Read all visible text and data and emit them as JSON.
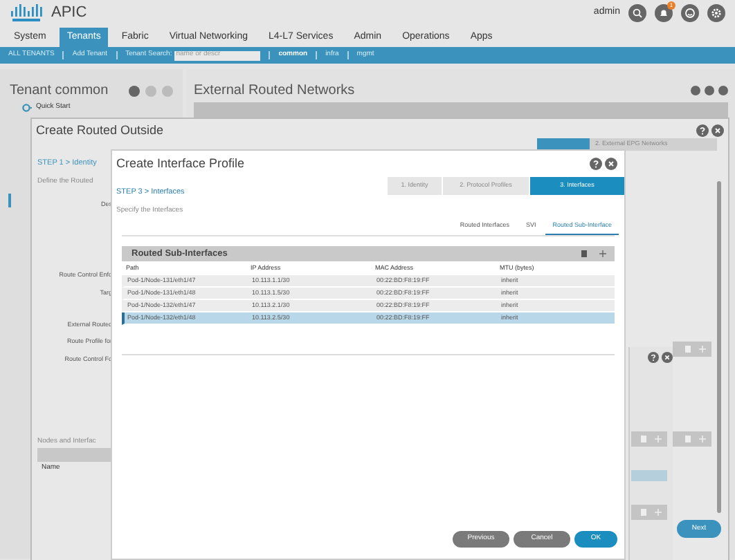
{
  "header": {
    "app_title": "APIC",
    "user": "admin",
    "notifications": "1"
  },
  "tabs": [
    {
      "label": "System",
      "selected": false
    },
    {
      "label": "Tenants",
      "selected": true
    },
    {
      "label": "Fabric",
      "selected": false
    },
    {
      "label": "Virtual Networking",
      "selected": false
    },
    {
      "label": "L4-L7 Services",
      "selected": false
    },
    {
      "label": "Admin",
      "selected": false
    },
    {
      "label": "Operations",
      "selected": false
    },
    {
      "label": "Apps",
      "selected": false
    }
  ],
  "subbar": {
    "all_tenants": "ALL TENANTS",
    "add_tenant": "Add Tenant",
    "search_label": "Tenant Search:",
    "search_placeholder": "name or descr",
    "tenants": [
      {
        "label": "common",
        "selected": true
      },
      {
        "label": "infra",
        "selected": false
      },
      {
        "label": "mgmt",
        "selected": false
      }
    ]
  },
  "left_panel": {
    "title": "Tenant common",
    "quick_start": "Quick Start"
  },
  "right_panel": {
    "title": "External Routed Networks"
  },
  "outer_dialog": {
    "title": "Create Routed Outside",
    "step_title": "STEP 1 > Identity",
    "step_desc": "Define the Routed",
    "next_step": "2. External EPG Networks",
    "labels": [
      "Des",
      "Route Control Enfo",
      "Targ",
      "External Routed",
      "Route Profile for",
      "Route Control Fo"
    ],
    "nodes_title": "Nodes and Interfac",
    "nodes_column": "Name",
    "next_button": "Next"
  },
  "dialog": {
    "title": "Create Interface Profile",
    "steps": [
      {
        "label": "1. Identity",
        "selected": false
      },
      {
        "label": "2. Protocol Profiles",
        "selected": false
      },
      {
        "label": "3. Interfaces",
        "selected": true
      }
    ],
    "step_title": "STEP 3 > Interfaces",
    "step_desc": "Specify the Interfaces",
    "subtabs": [
      {
        "label": "Routed Interfaces",
        "selected": false
      },
      {
        "label": "SVI",
        "selected": false
      },
      {
        "label": "Routed Sub-Interface",
        "selected": true
      }
    ],
    "table": {
      "title": "Routed Sub-Interfaces",
      "columns": [
        "Path",
        "IP Address",
        "MAC Address",
        "MTU (bytes)"
      ],
      "rows": [
        {
          "cells": [
            "Pod-1/Node-131/eth1/47",
            "10.113.1.1/30",
            "00:22:BD:F8:19:FF",
            "inherit"
          ],
          "selected": false
        },
        {
          "cells": [
            "Pod-1/Node-131/eth1/48",
            "10.113.1.5/30",
            "00:22:BD:F8:19:FF",
            "inherit"
          ],
          "selected": false
        },
        {
          "cells": [
            "Pod-1/Node-132/eth1/47",
            "10.113.2.1/30",
            "00:22:BD:F8:19:FF",
            "inherit"
          ],
          "selected": false
        },
        {
          "cells": [
            "Pod-1/Node-132/eth1/48",
            "10.113.2.5/30",
            "00:22:BD:F8:19:FF",
            "inherit"
          ],
          "selected": true
        }
      ]
    },
    "buttons": [
      {
        "label": "Previous",
        "kind": "secondary"
      },
      {
        "label": "Cancel",
        "kind": "secondary"
      },
      {
        "label": "OK",
        "kind": "primary"
      }
    ]
  }
}
